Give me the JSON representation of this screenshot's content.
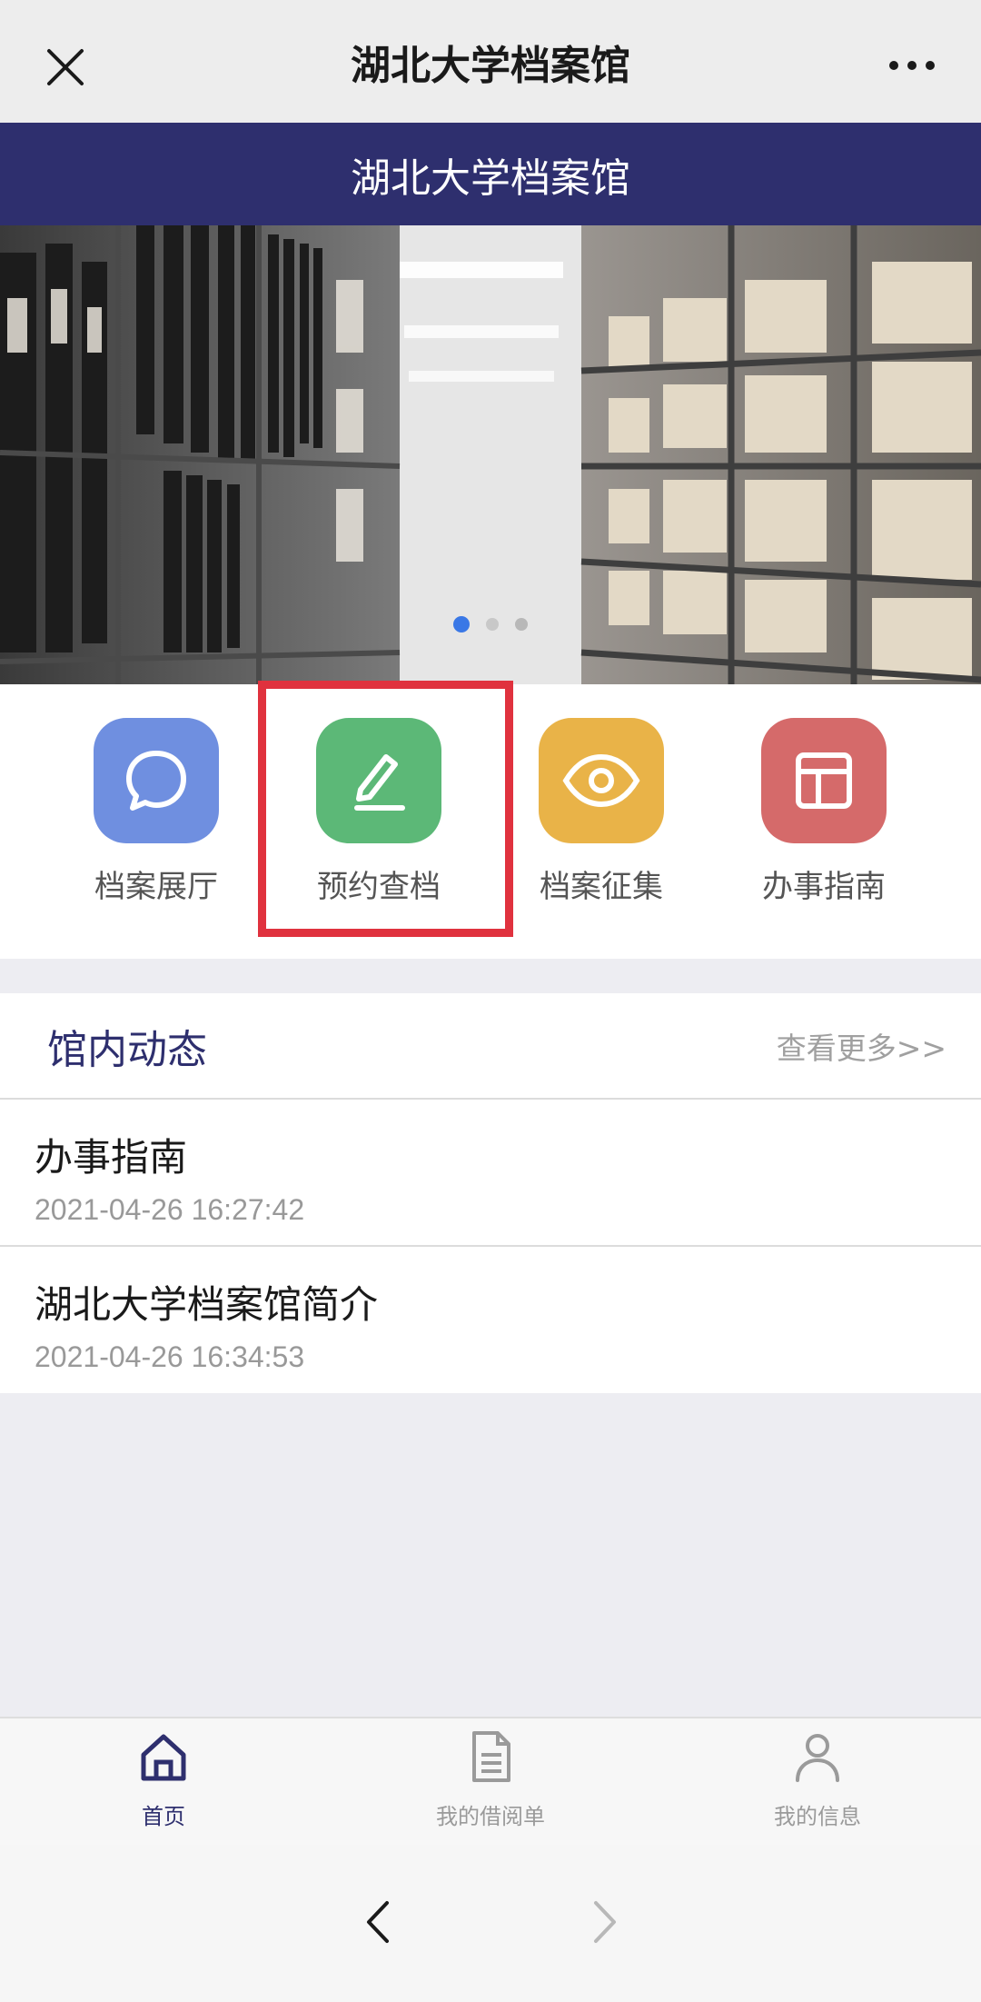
{
  "window": {
    "title": "湖北大学档案馆"
  },
  "banner": {
    "title": "湖北大学档案馆"
  },
  "carousel": {
    "pages": 3,
    "active_index": 0
  },
  "quick_actions": [
    {
      "label": "档案展厅",
      "icon": "chat-bubble-icon",
      "color": "#6f8fe0"
    },
    {
      "label": "预约查档",
      "icon": "pencil-icon",
      "color": "#5cb877"
    },
    {
      "label": "档案征集",
      "icon": "eye-icon",
      "color": "#e9b348"
    },
    {
      "label": "办事指南",
      "icon": "layout-icon",
      "color": "#d56a6a"
    }
  ],
  "news": {
    "title": "馆内动态",
    "more": "查看更多>>",
    "items": [
      {
        "title": "办事指南",
        "date": "2021-04-26 16:27:42"
      },
      {
        "title": "湖北大学档案馆简介",
        "date": "2021-04-26 16:34:53"
      }
    ]
  },
  "tabbar": [
    {
      "label": "首页",
      "icon": "home-icon",
      "active": true
    },
    {
      "label": "我的借阅单",
      "icon": "document-icon",
      "active": false
    },
    {
      "label": "我的信息",
      "icon": "user-icon",
      "active": false
    }
  ],
  "colors": {
    "brand": "#2e2f6e",
    "highlight": "#e0323e"
  }
}
